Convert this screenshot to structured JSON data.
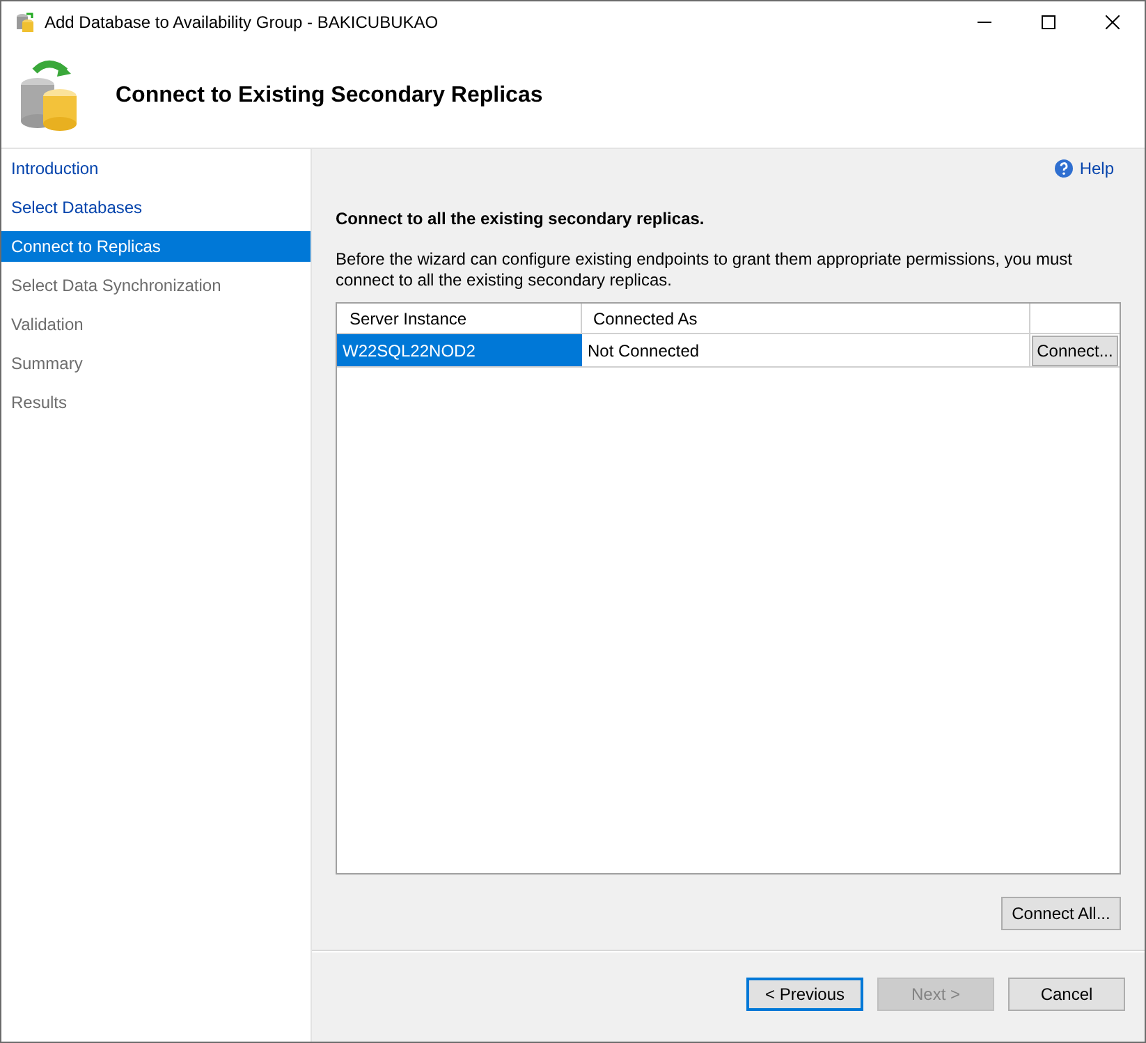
{
  "window": {
    "title": "Add Database to Availability Group - BAKICUBUKAO"
  },
  "header": {
    "title": "Connect to Existing Secondary Replicas"
  },
  "sidebar": {
    "items": [
      {
        "label": "Introduction",
        "selected": false,
        "enabled": true
      },
      {
        "label": "Select Databases",
        "selected": false,
        "enabled": true
      },
      {
        "label": "Connect to Replicas",
        "selected": true,
        "enabled": true
      },
      {
        "label": "Select Data Synchronization",
        "selected": false,
        "enabled": false
      },
      {
        "label": "Validation",
        "selected": false,
        "enabled": false
      },
      {
        "label": "Summary",
        "selected": false,
        "enabled": false
      },
      {
        "label": "Results",
        "selected": false,
        "enabled": false
      }
    ]
  },
  "help": "Help",
  "heading": "Connect to all the existing secondary replicas.",
  "description": "Before the wizard can configure existing endpoints to grant them appropriate permissions, you must connect to all the existing secondary replicas.",
  "table": {
    "columns": [
      "Server Instance",
      "Connected As"
    ],
    "rows": [
      {
        "server_instance": "W22SQL22NOD2",
        "connected_as": "Not Connected",
        "selected": true,
        "button": "Connect..."
      }
    ]
  },
  "connect_all": "Connect All...",
  "buttons": [
    {
      "label": "< Previous",
      "focused": true,
      "disabled": false
    },
    {
      "label": "Next >",
      "focused": false,
      "disabled": true
    },
    {
      "label": "Cancel",
      "focused": false,
      "disabled": false
    }
  ]
}
